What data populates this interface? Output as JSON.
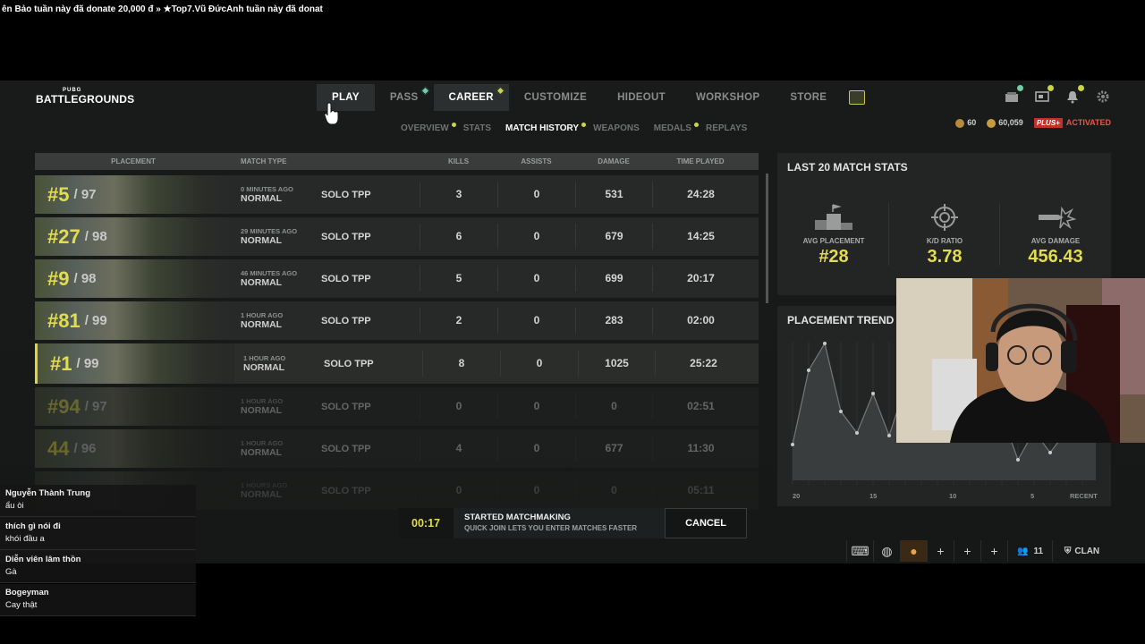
{
  "ticker": "ên Bảo tuần này đã donate 20,000 đ  »  ★Top7.Vũ ĐứcAnh tuần này đã donat",
  "logo": {
    "small": "PUBG",
    "big": "BATTLEGROUNDS"
  },
  "topnav": [
    {
      "label": "PLAY",
      "active": true
    },
    {
      "label": "PASS",
      "dot": "green"
    },
    {
      "label": "CAREER",
      "active": true,
      "dot": "yellow"
    },
    {
      "label": "CUSTOMIZE"
    },
    {
      "label": "HIDEOUT"
    },
    {
      "label": "WORKSHOP"
    },
    {
      "label": "STORE"
    }
  ],
  "subnav": [
    {
      "label": "OVERVIEW",
      "dot": true
    },
    {
      "label": "STATS"
    },
    {
      "label": "MATCH HISTORY",
      "active": true,
      "dot": true
    },
    {
      "label": "WEAPONS"
    },
    {
      "label": "MEDALS",
      "dot": true
    },
    {
      "label": "REPLAYS"
    }
  ],
  "currency": {
    "bp": "60",
    "gcoin": "60,059",
    "plus": "PLUS+",
    "status": "ACTIVATED"
  },
  "table": {
    "headers": [
      "PLACEMENT",
      "MATCH TYPE",
      "KILLS",
      "ASSISTS",
      "DAMAGE",
      "TIME PLAYED"
    ],
    "rows": [
      {
        "place": "#5",
        "total": "/ 97",
        "ago": "0 MINUTES AGO",
        "mode": "NORMAL",
        "type": "SOLO TPP",
        "kills": "3",
        "assists": "0",
        "damage": "531",
        "time": "24:28"
      },
      {
        "place": "#27",
        "total": "/ 98",
        "ago": "29 MINUTES AGO",
        "mode": "NORMAL",
        "type": "SOLO TPP",
        "kills": "6",
        "assists": "0",
        "damage": "679",
        "time": "14:25"
      },
      {
        "place": "#9",
        "total": "/ 98",
        "ago": "46 MINUTES AGO",
        "mode": "NORMAL",
        "type": "SOLO TPP",
        "kills": "5",
        "assists": "0",
        "damage": "699",
        "time": "20:17"
      },
      {
        "place": "#81",
        "total": "/ 99",
        "ago": "1 HOUR AGO",
        "mode": "NORMAL",
        "type": "SOLO TPP",
        "kills": "2",
        "assists": "0",
        "damage": "283",
        "time": "02:00"
      },
      {
        "place": "#1",
        "total": "/ 99",
        "ago": "1 HOUR AGO",
        "mode": "NORMAL",
        "type": "SOLO TPP",
        "kills": "8",
        "assists": "0",
        "damage": "1025",
        "time": "25:22",
        "win": true
      },
      {
        "place": "#94",
        "total": "/ 97",
        "ago": "1 HOUR AGO",
        "mode": "NORMAL",
        "type": "SOLO TPP",
        "kills": "0",
        "assists": "0",
        "damage": "0",
        "time": "02:51",
        "fade": 1
      },
      {
        "place": "44",
        "total": "/ 96",
        "ago": "1 HOUR AGO",
        "mode": "NORMAL",
        "type": "SOLO TPP",
        "kills": "4",
        "assists": "0",
        "damage": "677",
        "time": "11:30",
        "fade": 1
      },
      {
        "place": "",
        "total": "",
        "ago": "1 HOURS AGO",
        "mode": "NORMAL",
        "type": "SOLO TPP",
        "kills": "0",
        "assists": "0",
        "damage": "0",
        "time": "05:11",
        "fade": 2
      }
    ]
  },
  "stats": {
    "title": "LAST 20 MATCH STATS",
    "items": [
      {
        "label": "AVG PLACEMENT",
        "value": "#28",
        "icon": "podium-icon"
      },
      {
        "label": "K/D RATIO",
        "value": "3.78",
        "icon": "crosshair-icon"
      },
      {
        "label": "AVG DAMAGE",
        "value": "456.43",
        "icon": "bullet-icon"
      }
    ]
  },
  "trend": {
    "title": "PLACEMENT TREND",
    "x_labels": [
      "20",
      "15",
      "10",
      "5",
      "RECENT"
    ]
  },
  "chat": [
    {
      "user": "Nguyễn Thành Trung",
      "text": "ẩu òi"
    },
    {
      "user": "thích gì nói đi",
      "text": "khói đầu a"
    },
    {
      "user": "Diễn viên lâm thồn",
      "text": "Gà"
    },
    {
      "user": "Bogeyman",
      "text": "Cay thật"
    }
  ],
  "matchmaking": {
    "timer": "00:17",
    "title": "STARTED MATCHMAKING",
    "subtitle": "QUICK JOIN LETS YOU ENTER MATCHES FASTER",
    "cancel": "CANCEL"
  },
  "bottom": {
    "friends": "11",
    "clan": "CLAN"
  },
  "colors": {
    "accent": "#e2dc50",
    "panel": "#232525",
    "plus": "#c0322a"
  }
}
